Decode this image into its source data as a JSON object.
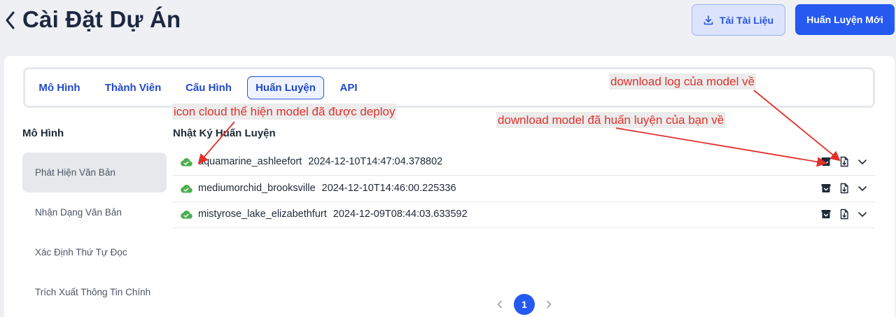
{
  "header": {
    "title": "Cài Đặt Dự Án",
    "download_doc_label": "Tải Tài Liệu",
    "new_training_label": "Huấn Luyện Mới"
  },
  "tabs": [
    {
      "label": "Mô Hình",
      "active": false
    },
    {
      "label": "Thành Viên",
      "active": false
    },
    {
      "label": "Cấu Hình",
      "active": false
    },
    {
      "label": "Huấn Luyện",
      "active": true
    },
    {
      "label": "API",
      "active": false
    }
  ],
  "sidebar": {
    "title": "Mô Hình",
    "items": [
      {
        "label": "Phát Hiện Văn Bản",
        "active": true
      },
      {
        "label": "Nhận Dạng Văn Bản",
        "active": false
      },
      {
        "label": "Xác Định Thứ Tự Đọc",
        "active": false
      },
      {
        "label": "Trích Xuất Thông Tin Chính",
        "active": false
      }
    ]
  },
  "log": {
    "title": "Nhật Ký Huấn Luyện",
    "rows": [
      {
        "name": "aquamarine_ashleefort",
        "timestamp": "2024-12-10T14:47:04.378802",
        "deployed": true
      },
      {
        "name": "mediumorchid_brooksville",
        "timestamp": "2024-12-10T14:46:00.225336",
        "deployed": true
      },
      {
        "name": "mistyrose_lake_elizabethfurt",
        "timestamp": "2024-12-09T08:44:03.633592",
        "deployed": true
      }
    ]
  },
  "pagination": {
    "current": "1"
  },
  "annotations": {
    "log": "download log của model về",
    "cloud": "icon cloud thể hiện model đã được deploy",
    "model": "download model đã huấn luyện của bạn về"
  },
  "colors": {
    "accent": "#2559f0",
    "deployed": "#4caf50",
    "annotation": "#e0302a",
    "background": "#eef0f4"
  },
  "icons": {
    "back": "chevron-left-icon",
    "download": "download-icon",
    "cloud": "cloud-check-icon",
    "model_download": "archive-box-icon",
    "log_download": "file-download-icon",
    "expand": "chevron-down-icon"
  }
}
